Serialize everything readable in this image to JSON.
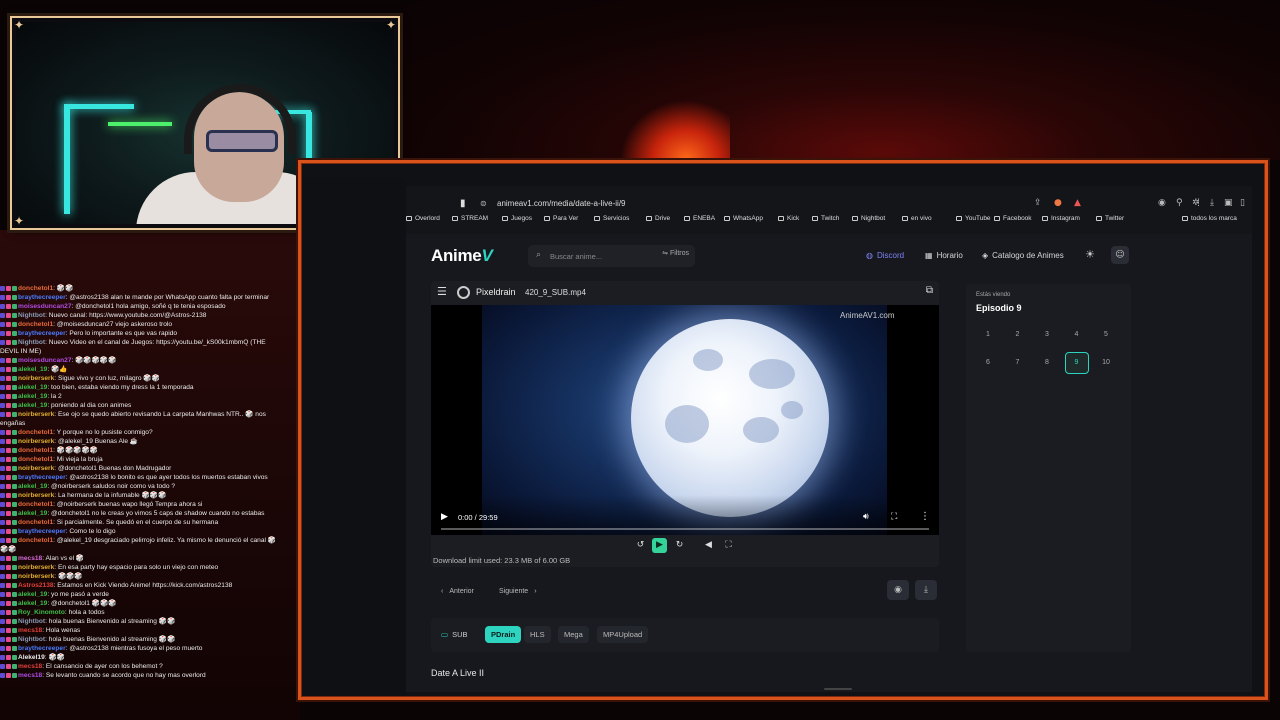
{
  "browser": {
    "url": "animeav1.com/media/date-a-live-ii/9",
    "bookmarks": [
      "Overlord",
      "STREAM",
      "Juegos",
      "Para Ver",
      "Servicios",
      "Drive",
      "ENEBA",
      "WhatsApp",
      "Kick",
      "Twitch",
      "Nightbot",
      "en vivo",
      "YouTube",
      "Facebook",
      "Instagram",
      "Twitter",
      "todos los marca"
    ]
  },
  "site": {
    "logo": "Anime",
    "logo_mark": "V",
    "search_placeholder": "Buscar anime...",
    "filters_label": "Filtros",
    "nav": {
      "discord": "Discord",
      "schedule": "Horario",
      "catalog": "Catalogo de Animes"
    }
  },
  "player": {
    "host": "Pixeldrain",
    "file_name": "420_9_SUB.mp4",
    "watermark": "AnimeAV1.com",
    "time": "0:00 / 29:59",
    "progress": 0,
    "download_limit": "Download limit used: 23.3 MB of 6.00 GB"
  },
  "episodes": {
    "watching_label": "Estás viendo",
    "current": "Episodio 9",
    "list": [
      "1",
      "2",
      "3",
      "4",
      "5",
      "6",
      "7",
      "8",
      "9",
      "10"
    ],
    "active": "9"
  },
  "navigation": {
    "prev": "Anterior",
    "next": "Siguiente"
  },
  "servers": {
    "sub_label": "SUB",
    "list": [
      "PDrain",
      "HLS",
      "Mega",
      "MP4Upload"
    ],
    "active": "PDrain"
  },
  "anime_title": "Date A Live II",
  "chat": [
    {
      "user": "donchetol1",
      "color": "#e86a3a",
      "text": "🎲🎲"
    },
    {
      "user": "braythecreeper",
      "color": "#4a7bff",
      "text": "@astros2138 alan te mande por WhatsApp cuanto falta por terminar",
      "wrap": true
    },
    {
      "user": "moisesduncan27",
      "color": "#b04be0",
      "text": "@donchetol1 hola amigo, soñé q te tenia esposado"
    },
    {
      "user": "Nightbot",
      "color": "#8a9bb5",
      "text": "Nuevo canal: https://www.youtube.com/@Astros-2138"
    },
    {
      "user": "donchetol1",
      "color": "#e86a3a",
      "text": "@moisesduncan27 viejo askeroso trolo"
    },
    {
      "user": "braythecreeper",
      "color": "#4a7bff",
      "text": "Pero lo importante es que vas rapido"
    },
    {
      "user": "Nightbot",
      "color": "#8a9bb5",
      "text": "Nuevo Video en el canal de Juegos: https://youtu.be/_kS00k1mbmQ (THE DEVIL IN ME)",
      "wrap": true
    },
    {
      "user": "moisesduncan27",
      "color": "#b04be0",
      "text": "🎲🎲🎲🎲🎲"
    },
    {
      "user": "alekel_19",
      "color": "#3bbf4a",
      "text": "🎲👍"
    },
    {
      "user": "noirberserk",
      "color": "#e0b030",
      "text": "Sigue vivo y con luz, milagro 🎲🎲"
    },
    {
      "user": "alekel_19",
      "color": "#3bbf4a",
      "text": "too bien, estaba viendo my dress la 1 temporada"
    },
    {
      "user": "alekel_19",
      "color": "#3bbf4a",
      "text": "la 2"
    },
    {
      "user": "alekel_19",
      "color": "#3bbf4a",
      "text": "poniendo al dia con animes"
    },
    {
      "user": "noirberserk",
      "color": "#e0b030",
      "text": "Ese ojo se quedo abierto revisando La carpeta Manhwas NTR.. 🎲 nos engañas",
      "wrap": true
    },
    {
      "user": "donchetol1",
      "color": "#e86a3a",
      "text": "Y porque no lo pusiste conmigo?"
    },
    {
      "user": "noirberserk",
      "color": "#e0b030",
      "text": "@alekel_19 Buenas Ale ☕"
    },
    {
      "user": "donchetol1",
      "color": "#e86a3a",
      "text": "🎲🎲🎲🎲🎲"
    },
    {
      "user": "donchetol1",
      "color": "#e86a3a",
      "text": "Mi vieja la bruja"
    },
    {
      "user": "noirberserk",
      "color": "#e0b030",
      "text": "@donchetol1 Buenas don Madrugador"
    },
    {
      "user": "braythecreeper",
      "color": "#4a7bff",
      "text": "@astros2138 lo bonito es que ayer todos los muertos estaban vivos",
      "wrap": true
    },
    {
      "user": "alekel_19",
      "color": "#3bbf4a",
      "text": "@noirberserk saludos noir como va todo ?"
    },
    {
      "user": "noirberserk",
      "color": "#e0b030",
      "text": "La hermana de la infumable 🎲🎲🎲"
    },
    {
      "user": "donchetol1",
      "color": "#e86a3a",
      "text": "@noirberserk buenas wapo llegó Tempra ahora si"
    },
    {
      "user": "alekel_19",
      "color": "#3bbf4a",
      "text": "@donchetol1 no le creas yo vimos 5 caps de shadow cuando no estabas",
      "wrap": true
    },
    {
      "user": "donchetol1",
      "color": "#e86a3a",
      "text": "Si parcialmente. Se quedó en el cuerpo de su hermana"
    },
    {
      "user": "braythecreeper",
      "color": "#4a7bff",
      "text": "Como te lo digo"
    },
    {
      "user": "donchetol1",
      "color": "#e86a3a",
      "text": "@alekel_19 desgraciado pelirrojo infeliz. Ya mismo le denunció el canal 🎲🎲🎲",
      "wrap": true
    },
    {
      "user": "mecs18",
      "color": "#d36bd6",
      "text": "Alan vs el 🎲"
    },
    {
      "user": "noirberserk",
      "color": "#e0b030",
      "text": "En esa party hay espacio para solo un viejo con meteo"
    },
    {
      "user": "noirberserk",
      "color": "#e0b030",
      "text": "🎲🎲🎲"
    },
    {
      "user": "Astros2138",
      "color": "#e0403a",
      "text": "Estamos en Kick Viendo Anime! https://kick.com/astros2138"
    },
    {
      "user": "alekel_19",
      "color": "#3bbf4a",
      "text": "yo me pasó a verde"
    },
    {
      "user": "alekel_19",
      "color": "#3bbf4a",
      "text": "@donchetol1 🎲🎲🎲"
    },
    {
      "user": "Roy_Kinomoto",
      "color": "#3bbf4a",
      "text": "hola a todos"
    },
    {
      "user": "Nightbot",
      "color": "#8a9bb5",
      "text": "hola buenas Bienvenido al streaming 🎲🎲"
    },
    {
      "user": "mecs18",
      "color": "#e0403a",
      "text": "Hola wenas"
    },
    {
      "user": "Nightbot",
      "color": "#8a9bb5",
      "text": "hola buenas Bienvenido al streaming 🎲🎲"
    },
    {
      "user": "braythecreeper",
      "color": "#4a7bff",
      "text": "@astros2138 mientras fusoya el peso muerto"
    },
    {
      "user": "Alekel19",
      "color": "#eaeaea",
      "text": "🎲🎲"
    },
    {
      "user": "mecs18",
      "color": "#e0403a",
      "text": "El cansancio de ayer con los behemot ?"
    },
    {
      "user": "mecs18",
      "color": "#b04be0",
      "text": "Se levanto cuando se acordo que no hay mas overlord"
    }
  ]
}
